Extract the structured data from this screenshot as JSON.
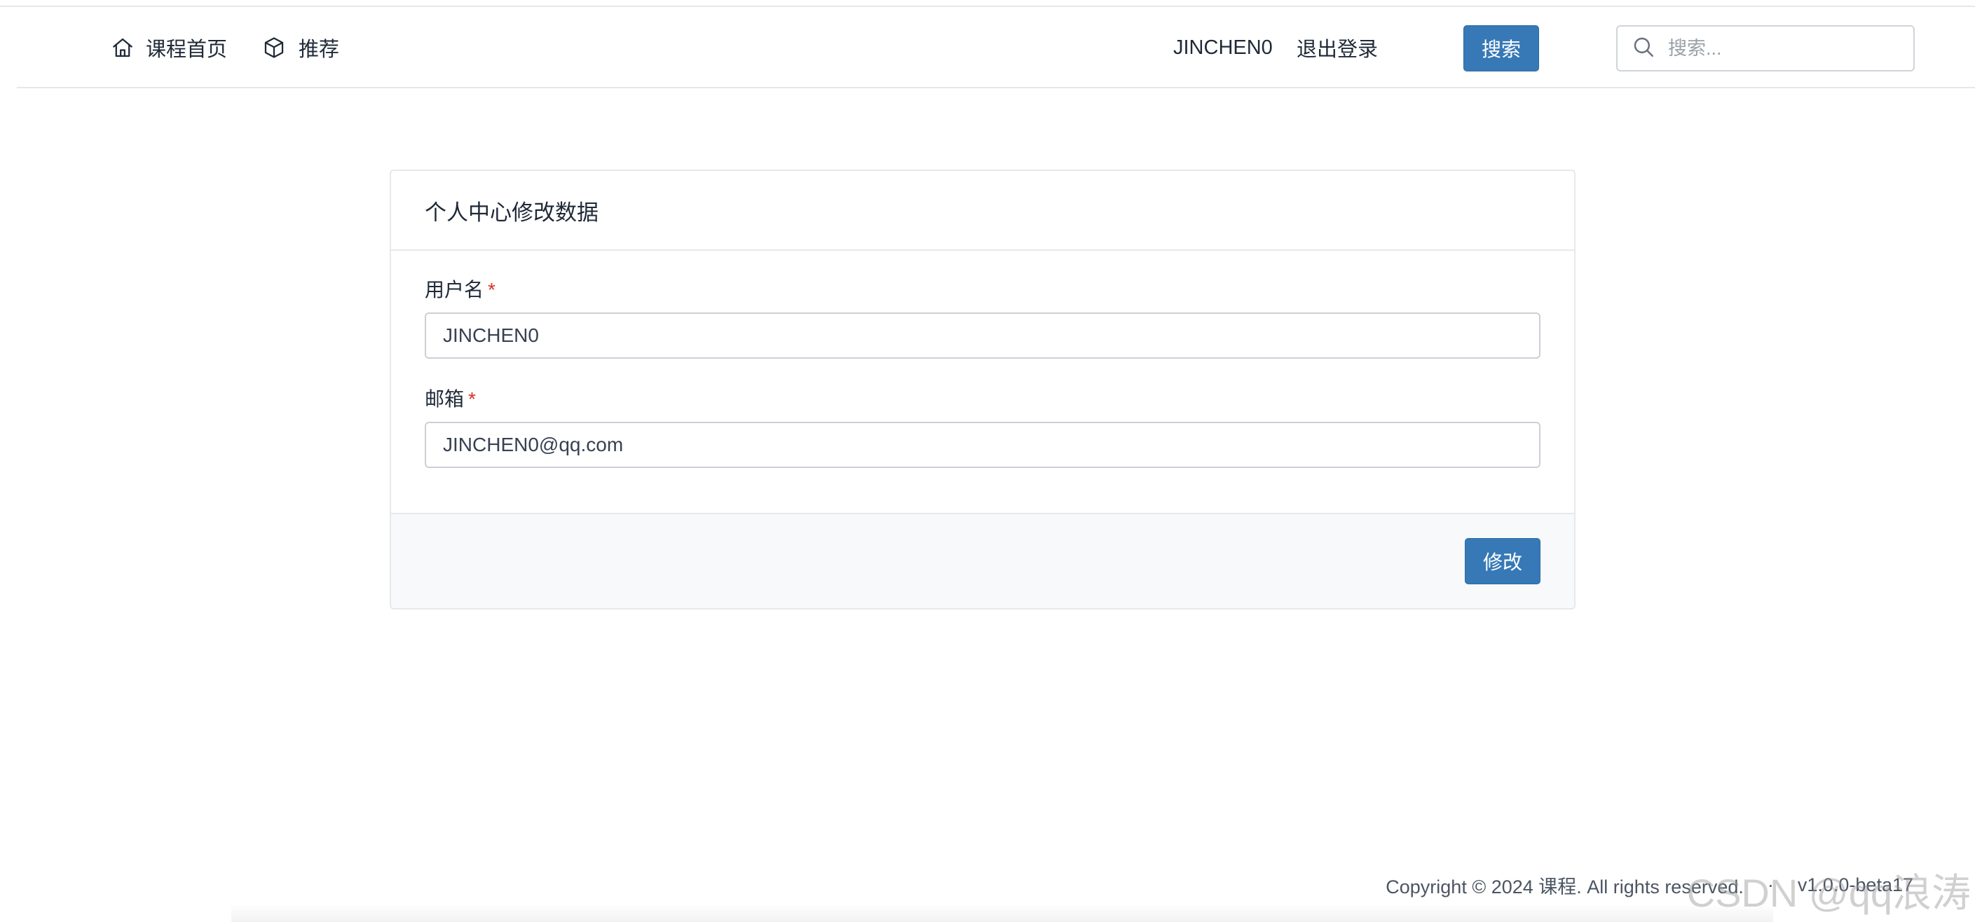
{
  "nav": {
    "home_label": "课程首页",
    "recommend_label": "推荐",
    "username": "JINCHEN0",
    "logout_label": "退出登录",
    "search_button_label": "搜索",
    "search_placeholder": "搜索..."
  },
  "form": {
    "title": "个人中心修改数据",
    "username_label": "用户名",
    "username_value": "JINCHEN0",
    "email_label": "邮箱",
    "email_value": "JINCHEN0@qq.com",
    "required_mark": "*",
    "submit_label": "修改"
  },
  "footer": {
    "copyright": "Copyright © 2024 课程. All rights reserved.",
    "separator": "·",
    "version": "v1.0.0-beta17"
  },
  "watermark": "CSDN @qq浪涛",
  "colors": {
    "primary": "#3779b6",
    "required": "#d93025",
    "footer_bg": "#f8f9fb"
  },
  "icons": {
    "home": "home-icon",
    "recommend": "cube-icon",
    "search": "search-icon"
  }
}
